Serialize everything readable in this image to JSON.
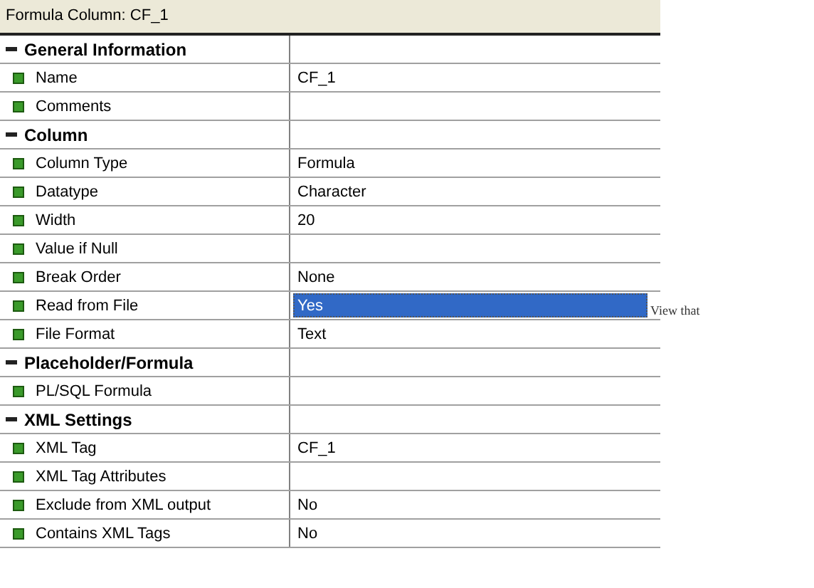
{
  "window": {
    "title": "Formula Column: CF_1"
  },
  "rows": [
    {
      "kind": "section",
      "label": "General Information",
      "expanded": true
    },
    {
      "kind": "property",
      "label": "Name",
      "value": "CF_1",
      "selected": false
    },
    {
      "kind": "property",
      "label": "Comments",
      "selected": false
    },
    {
      "kind": "section",
      "label": "Column",
      "expanded": true
    },
    {
      "kind": "property",
      "label": "Column Type",
      "value": "Formula",
      "selected": false
    },
    {
      "kind": "property",
      "label": "Datatype",
      "value": "Character",
      "selected": false
    },
    {
      "kind": "property",
      "label": "Width",
      "value": "20",
      "selected": false
    },
    {
      "kind": "property",
      "label": "Value if Null",
      "selected": false
    },
    {
      "kind": "property",
      "label": "Break Order",
      "value": "None",
      "selected": false
    },
    {
      "kind": "property",
      "label": "Read from File",
      "value": "Yes",
      "selected": true
    },
    {
      "kind": "property",
      "label": "File Format",
      "value": "Text",
      "selected": false
    },
    {
      "kind": "section",
      "label": "Placeholder/Formula",
      "expanded": true
    },
    {
      "kind": "property",
      "label": "PL/SQL Formula",
      "selected": false
    },
    {
      "kind": "section",
      "label": "XML Settings",
      "expanded": true
    },
    {
      "kind": "property",
      "label": "XML Tag",
      "value": "CF_1",
      "selected": false
    },
    {
      "kind": "property",
      "label": "XML Tag Attributes",
      "selected": false
    },
    {
      "kind": "property",
      "label": "Exclude from XML output",
      "value": "No",
      "selected": false
    },
    {
      "kind": "property",
      "label": "Contains XML Tags",
      "value": "No",
      "selected": false
    }
  ],
  "tooltip_fragment": "View that"
}
